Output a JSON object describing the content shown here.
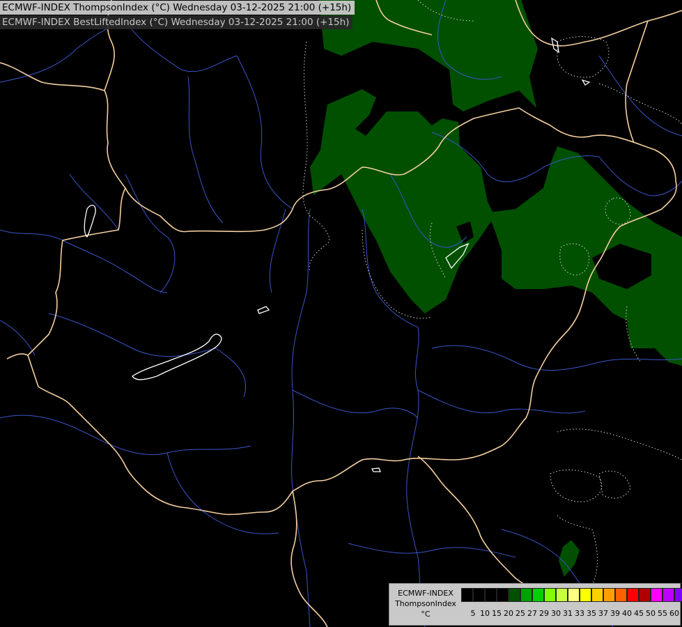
{
  "titles": {
    "line1": "ECMWF-INDEX ThompsonIndex (°C) Wednesday 03-12-2025 21:00 (+15h)",
    "line2": "ECMWF-INDEX BestLiftedIndex (°C) Wednesday 03-12-2025 21:00 (+15h)"
  },
  "legend": {
    "line1": "ECMWF-INDEX",
    "line2": "ThompsonIndex",
    "unit": "°C",
    "colors": [
      "#000000",
      "#000000",
      "#000000",
      "#000000",
      "#005000",
      "#00a000",
      "#00d000",
      "#80ff00",
      "#c8ff40",
      "#ffff80",
      "#ffff00",
      "#ffd000",
      "#ffa000",
      "#ff6000",
      "#ff0000",
      "#b00000",
      "#ff00ff",
      "#c000ff",
      "#8000ff",
      "#4000ff",
      "#0000ff"
    ],
    "labels": [
      "5",
      "10",
      "15",
      "20",
      "25",
      "27",
      "29",
      "30",
      "31",
      "33",
      "35",
      "37",
      "39",
      "40",
      "45",
      "50",
      "55",
      "60"
    ]
  },
  "colors": {
    "background": "#000000",
    "positive_area": "#005000",
    "border": "#f5cfa0",
    "river": "#3c55c8",
    "contour": "#d8d8d8",
    "lake": "#ffffff"
  }
}
